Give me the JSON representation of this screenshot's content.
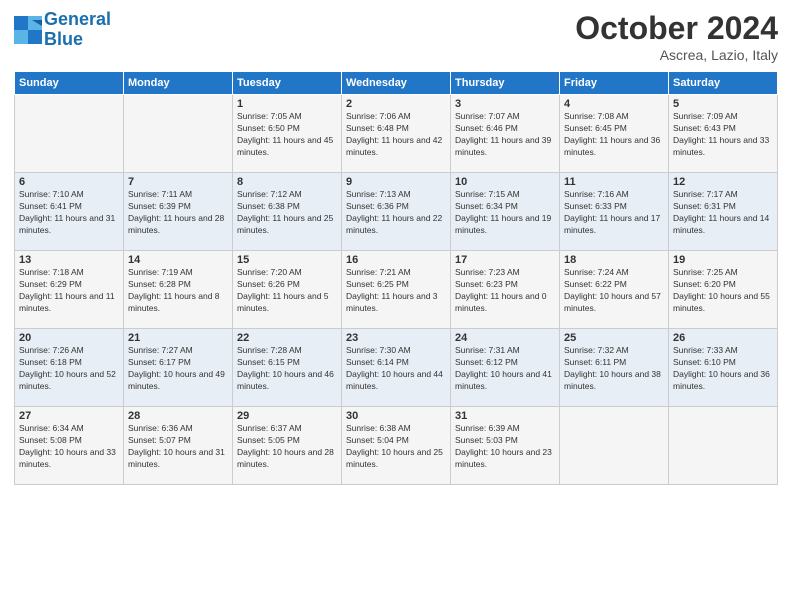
{
  "logo": {
    "line1": "General",
    "line2": "Blue"
  },
  "title": "October 2024",
  "location": "Ascrea, Lazio, Italy",
  "days_of_week": [
    "Sunday",
    "Monday",
    "Tuesday",
    "Wednesday",
    "Thursday",
    "Friday",
    "Saturday"
  ],
  "weeks": [
    [
      {
        "day": "",
        "info": ""
      },
      {
        "day": "",
        "info": ""
      },
      {
        "day": "1",
        "info": "Sunrise: 7:05 AM\nSunset: 6:50 PM\nDaylight: 11 hours and 45 minutes."
      },
      {
        "day": "2",
        "info": "Sunrise: 7:06 AM\nSunset: 6:48 PM\nDaylight: 11 hours and 42 minutes."
      },
      {
        "day": "3",
        "info": "Sunrise: 7:07 AM\nSunset: 6:46 PM\nDaylight: 11 hours and 39 minutes."
      },
      {
        "day": "4",
        "info": "Sunrise: 7:08 AM\nSunset: 6:45 PM\nDaylight: 11 hours and 36 minutes."
      },
      {
        "day": "5",
        "info": "Sunrise: 7:09 AM\nSunset: 6:43 PM\nDaylight: 11 hours and 33 minutes."
      }
    ],
    [
      {
        "day": "6",
        "info": "Sunrise: 7:10 AM\nSunset: 6:41 PM\nDaylight: 11 hours and 31 minutes."
      },
      {
        "day": "7",
        "info": "Sunrise: 7:11 AM\nSunset: 6:39 PM\nDaylight: 11 hours and 28 minutes."
      },
      {
        "day": "8",
        "info": "Sunrise: 7:12 AM\nSunset: 6:38 PM\nDaylight: 11 hours and 25 minutes."
      },
      {
        "day": "9",
        "info": "Sunrise: 7:13 AM\nSunset: 6:36 PM\nDaylight: 11 hours and 22 minutes."
      },
      {
        "day": "10",
        "info": "Sunrise: 7:15 AM\nSunset: 6:34 PM\nDaylight: 11 hours and 19 minutes."
      },
      {
        "day": "11",
        "info": "Sunrise: 7:16 AM\nSunset: 6:33 PM\nDaylight: 11 hours and 17 minutes."
      },
      {
        "day": "12",
        "info": "Sunrise: 7:17 AM\nSunset: 6:31 PM\nDaylight: 11 hours and 14 minutes."
      }
    ],
    [
      {
        "day": "13",
        "info": "Sunrise: 7:18 AM\nSunset: 6:29 PM\nDaylight: 11 hours and 11 minutes."
      },
      {
        "day": "14",
        "info": "Sunrise: 7:19 AM\nSunset: 6:28 PM\nDaylight: 11 hours and 8 minutes."
      },
      {
        "day": "15",
        "info": "Sunrise: 7:20 AM\nSunset: 6:26 PM\nDaylight: 11 hours and 5 minutes."
      },
      {
        "day": "16",
        "info": "Sunrise: 7:21 AM\nSunset: 6:25 PM\nDaylight: 11 hours and 3 minutes."
      },
      {
        "day": "17",
        "info": "Sunrise: 7:23 AM\nSunset: 6:23 PM\nDaylight: 11 hours and 0 minutes."
      },
      {
        "day": "18",
        "info": "Sunrise: 7:24 AM\nSunset: 6:22 PM\nDaylight: 10 hours and 57 minutes."
      },
      {
        "day": "19",
        "info": "Sunrise: 7:25 AM\nSunset: 6:20 PM\nDaylight: 10 hours and 55 minutes."
      }
    ],
    [
      {
        "day": "20",
        "info": "Sunrise: 7:26 AM\nSunset: 6:18 PM\nDaylight: 10 hours and 52 minutes."
      },
      {
        "day": "21",
        "info": "Sunrise: 7:27 AM\nSunset: 6:17 PM\nDaylight: 10 hours and 49 minutes."
      },
      {
        "day": "22",
        "info": "Sunrise: 7:28 AM\nSunset: 6:15 PM\nDaylight: 10 hours and 46 minutes."
      },
      {
        "day": "23",
        "info": "Sunrise: 7:30 AM\nSunset: 6:14 PM\nDaylight: 10 hours and 44 minutes."
      },
      {
        "day": "24",
        "info": "Sunrise: 7:31 AM\nSunset: 6:12 PM\nDaylight: 10 hours and 41 minutes."
      },
      {
        "day": "25",
        "info": "Sunrise: 7:32 AM\nSunset: 6:11 PM\nDaylight: 10 hours and 38 minutes."
      },
      {
        "day": "26",
        "info": "Sunrise: 7:33 AM\nSunset: 6:10 PM\nDaylight: 10 hours and 36 minutes."
      }
    ],
    [
      {
        "day": "27",
        "info": "Sunrise: 6:34 AM\nSunset: 5:08 PM\nDaylight: 10 hours and 33 minutes."
      },
      {
        "day": "28",
        "info": "Sunrise: 6:36 AM\nSunset: 5:07 PM\nDaylight: 10 hours and 31 minutes."
      },
      {
        "day": "29",
        "info": "Sunrise: 6:37 AM\nSunset: 5:05 PM\nDaylight: 10 hours and 28 minutes."
      },
      {
        "day": "30",
        "info": "Sunrise: 6:38 AM\nSunset: 5:04 PM\nDaylight: 10 hours and 25 minutes."
      },
      {
        "day": "31",
        "info": "Sunrise: 6:39 AM\nSunset: 5:03 PM\nDaylight: 10 hours and 23 minutes."
      },
      {
        "day": "",
        "info": ""
      },
      {
        "day": "",
        "info": ""
      }
    ]
  ]
}
